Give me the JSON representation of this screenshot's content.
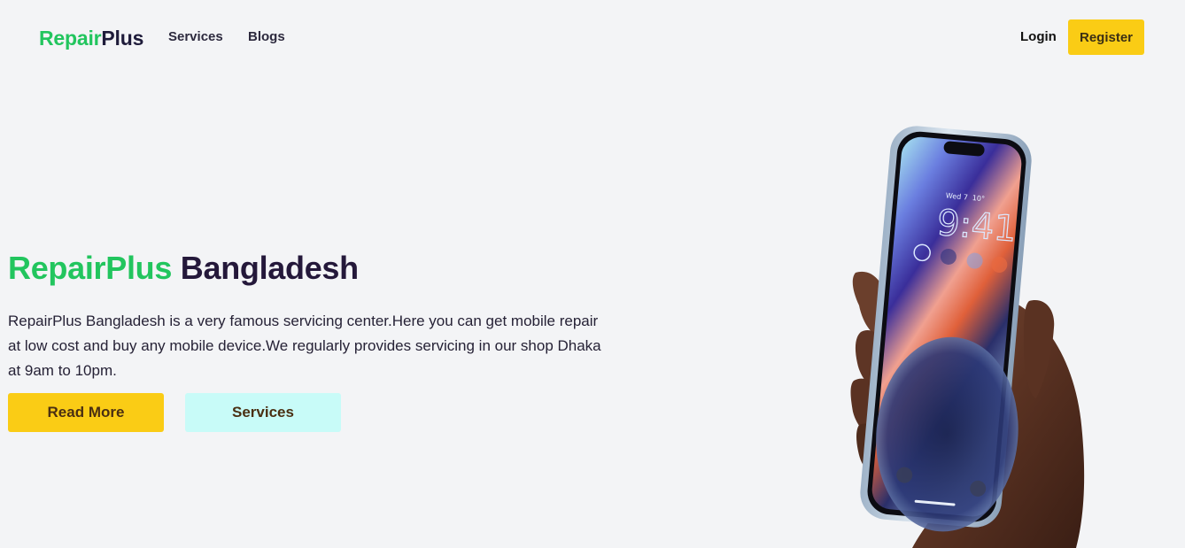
{
  "nav": {
    "brand_part1": "Repair",
    "brand_part2": "Plus",
    "links": [
      "Services",
      "Blogs"
    ],
    "login": "Login",
    "register": "Register"
  },
  "hero": {
    "title_part1": "RepairPlus",
    "title_part2": "Bangladesh",
    "description": "RepairPlus Bangladesh is a very famous servicing center.Here you can get mobile repair at low cost and buy any mobile device.We regularly provides servicing in our shop Dhaka at 9am to 10pm.",
    "read_more": "Read More",
    "services": "Services"
  },
  "phone": {
    "date": "Wed 7",
    "temp": "10°",
    "time": "9:41"
  },
  "colors": {
    "brand_green": "#22c55e",
    "accent_yellow": "#facc15",
    "accent_cyan": "#c8fbf8",
    "background": "#f3f4f6"
  }
}
